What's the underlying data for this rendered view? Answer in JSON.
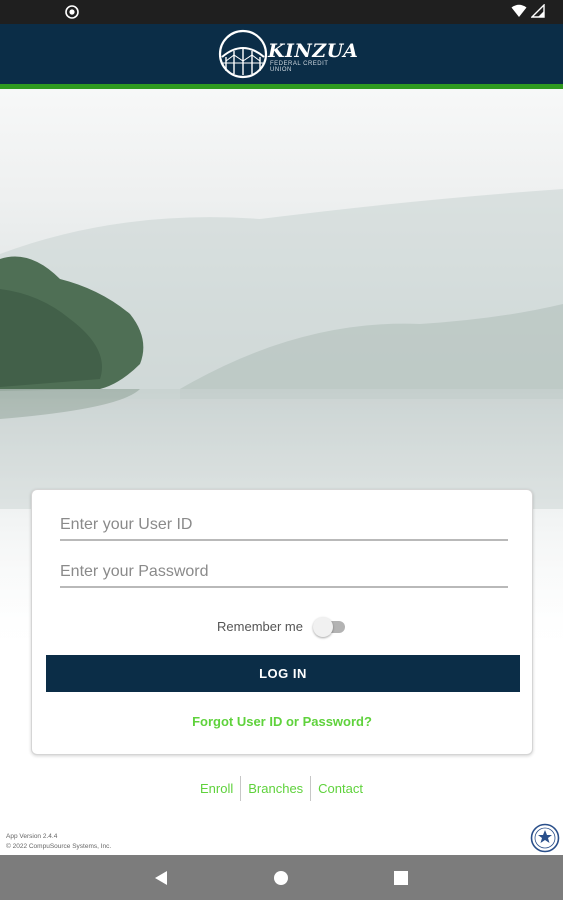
{
  "status_bar": {
    "left_icon": "notification-app-icon",
    "right_icons": [
      "wifi-icon",
      "cellular-signal-icon"
    ]
  },
  "header": {
    "brand_name": "KINZUA",
    "brand_tagline": "FEDERAL CREDIT UNION",
    "colors": {
      "background": "#0b2d47",
      "stripe": "#2f9a1f"
    }
  },
  "login_form": {
    "user_id_placeholder": "Enter your User ID",
    "user_id_value": "",
    "password_placeholder": "Enter your Password",
    "password_value": "",
    "remember_label": "Remember me",
    "remember_on": false,
    "login_label": "LOG IN",
    "forgot_label": "Forgot User ID or Password?"
  },
  "footer_links": [
    "Enroll",
    "Branches",
    "Contact"
  ],
  "footer": {
    "app_version": "App Version 2.4.4",
    "copyright": "© 2022 CompuSource Systems, Inc."
  },
  "nav_bar": [
    "back-icon",
    "home-icon",
    "recents-icon"
  ],
  "colors": {
    "accent_green": "#5fd23c",
    "primary_navy": "#0b2d47"
  }
}
